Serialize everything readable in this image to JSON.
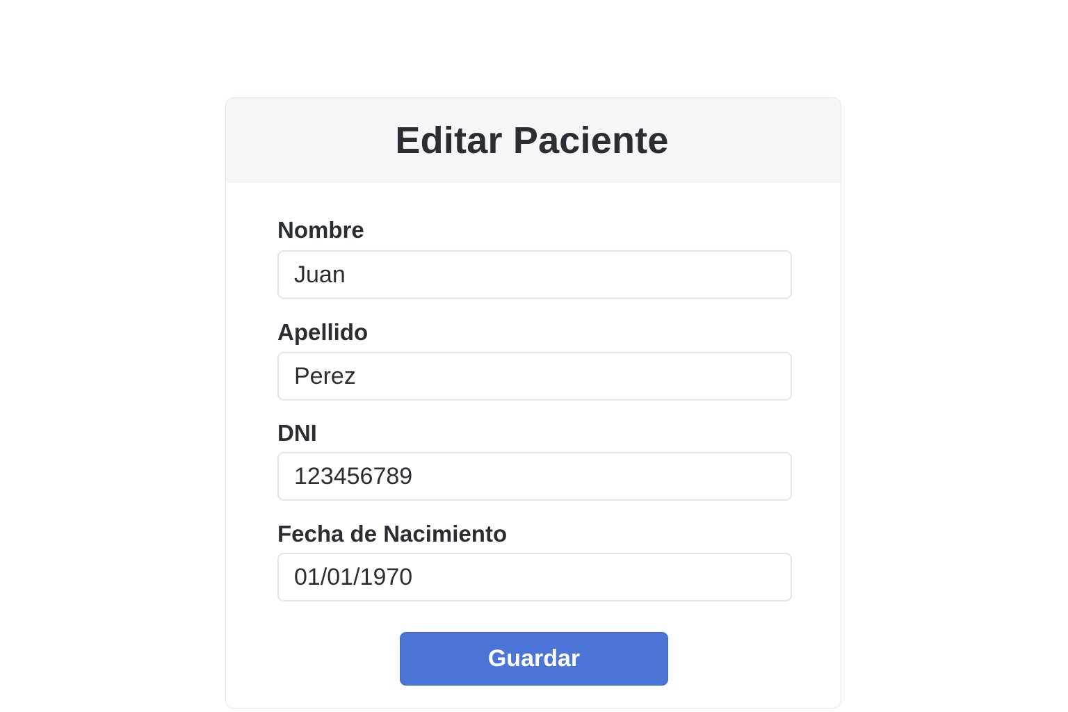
{
  "form": {
    "title": "Editar Paciente",
    "fields": [
      {
        "label": "Nombre",
        "value": "Juan"
      },
      {
        "label": "Apellido",
        "value": "Perez"
      },
      {
        "label": "DNI",
        "value": "123456789"
      },
      {
        "label": "Fecha de Nacimiento",
        "value": "01/01/1970"
      }
    ],
    "save_label": "Guardar"
  },
  "colors": {
    "accent": "#4a74d5",
    "header_bg": "#f5f6f8",
    "border": "#e3e5ea",
    "text": "#2a2d34"
  }
}
